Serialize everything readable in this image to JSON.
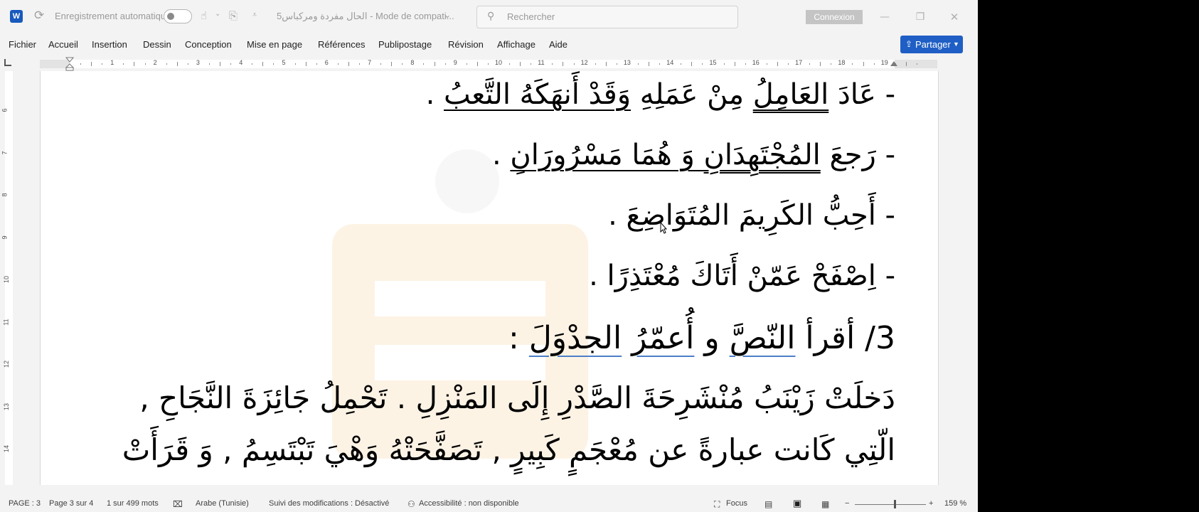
{
  "titlebar": {
    "app_icon": "word-logo",
    "autosave_label": "Enregistrement automatique",
    "autosave_state": "off",
    "doc_title": "الحال مفردة ومركباس5  -  Mode de compati...",
    "search_placeholder": "Rechercher",
    "signin_label": "Connexion",
    "minimize": "—",
    "restore": "❐",
    "close": "✕"
  },
  "menu": {
    "items": [
      "Fichier",
      "Accueil",
      "Insertion",
      "Dessin",
      "Conception",
      "Mise en page",
      "Références",
      "Publipostage",
      "Révision",
      "Affichage",
      "Aide"
    ],
    "share_label": "Partager"
  },
  "ruler": {
    "horizontal_numbers": [
      "1",
      "2",
      "3",
      "4",
      "5",
      "6",
      "7",
      "8",
      "9",
      "10",
      "11",
      "12",
      "13",
      "14",
      "15",
      "16",
      "17",
      "18",
      "19"
    ],
    "vertical_numbers": [
      "6",
      "7",
      "8",
      "9",
      "10",
      "11",
      "12",
      "13",
      "14"
    ]
  },
  "document": {
    "line1": {
      "dash": "-",
      "a": "عَادَ ",
      "b": "العَامِلُ",
      "c": " مِنْ عَمَلِهِ ",
      "d": "وَقَدْ أَنهَكَهُ التَّعبُ",
      "e": " ."
    },
    "line2": {
      "dash": "-",
      "a": " رَجعَ ",
      "b": "المُجْتَهِدَانِ",
      "c": " وَ هُمَا مَسْرُورَانِ",
      "d": " ."
    },
    "line3": "- أَحِبُّ الكَرِيمَ المُتَوَاضِعَ .",
    "line4": "- اِصْفَحْ عَمّنْ أَتَاكَ  مُعْتَذِرًا .",
    "line5": {
      "num": "3/",
      "a": " أقرأ ",
      "b": "النّصَّ",
      "c": " و ",
      "d": "أُعمّرُ",
      "e": " ",
      "f": "الجدْوَلَ",
      "g": " :"
    },
    "line6": "دَخلَتْ زَيْنَبُ مُنْشَرِحَةَ الصَّدْرِ إِلَى المَنْزِلِ . تَحْمِلُ جَائِزَةَ النَّجَاحِ ,",
    "line7": "الّتِي كَانت عبارةً عن مُعْجَمٍ كَبِيرٍ , تَصَفَّحَتْهُ وَهْيَ تَبْتَسِمُ , وَ قَرَأَتْ"
  },
  "status": {
    "page_section": "PAGE : 3",
    "page_of": "Page 3 sur 4",
    "word_count": "1 sur 499 mots",
    "language": "Arabe (Tunisie)",
    "track_changes": "Suivi des modifications : Désactivé",
    "accessibility": "Accessibilité : non disponible",
    "focus": "Focus",
    "zoom": "159 %",
    "zoom_minus": "−",
    "zoom_plus": "+"
  },
  "colors": {
    "accent": "#1f5fc5",
    "word_blue": "#185abd",
    "background": "#f3f3f3",
    "spelling_underline": "#4d7fc8"
  }
}
